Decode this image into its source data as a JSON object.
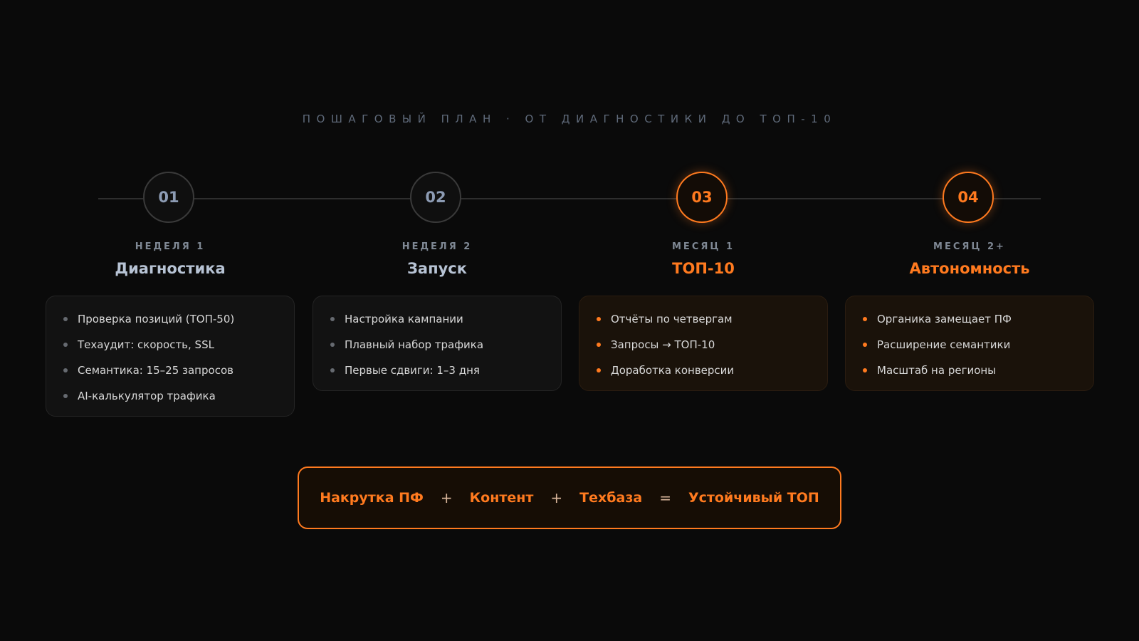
{
  "header": {
    "eyebrow": "Пошаговый план · от диагностики до ТОП-10"
  },
  "colors": {
    "accent": "#ff7a1f",
    "background": "#0a0a0a",
    "inactive_circle": "#3a3a3a"
  },
  "steps": [
    {
      "number": "01",
      "period": "Неделя 1",
      "title": "Диагностика",
      "active": false,
      "items": [
        "Проверка позиций (ТОП-50)",
        "Техаудит: скорость, SSL",
        "Семантика: 15–25 запросов",
        "AI-калькулятор трафика"
      ]
    },
    {
      "number": "02",
      "period": "Неделя 2",
      "title": "Запуск",
      "active": false,
      "items": [
        "Настройка кампании",
        "Плавный набор трафика",
        "Первые сдвиги: 1–3 дня"
      ]
    },
    {
      "number": "03",
      "period": "Месяц 1",
      "title": "ТОП-10",
      "active": true,
      "items": [
        "Отчёты по четвергам",
        "Запросы → ТОП-10",
        "Доработка конверсии"
      ]
    },
    {
      "number": "04",
      "period": "Месяц 2+",
      "title": "Автономность",
      "active": true,
      "items": [
        "Органика замещает ПФ",
        "Расширение семантики",
        "Масштаб на регионы"
      ]
    }
  ],
  "formula": {
    "term1": "Накрутка ПФ",
    "op1": "+",
    "term2": "Контент",
    "op2": "+",
    "term3": "Техбаза",
    "op3": "=",
    "result": "Устойчивый ТОП"
  }
}
